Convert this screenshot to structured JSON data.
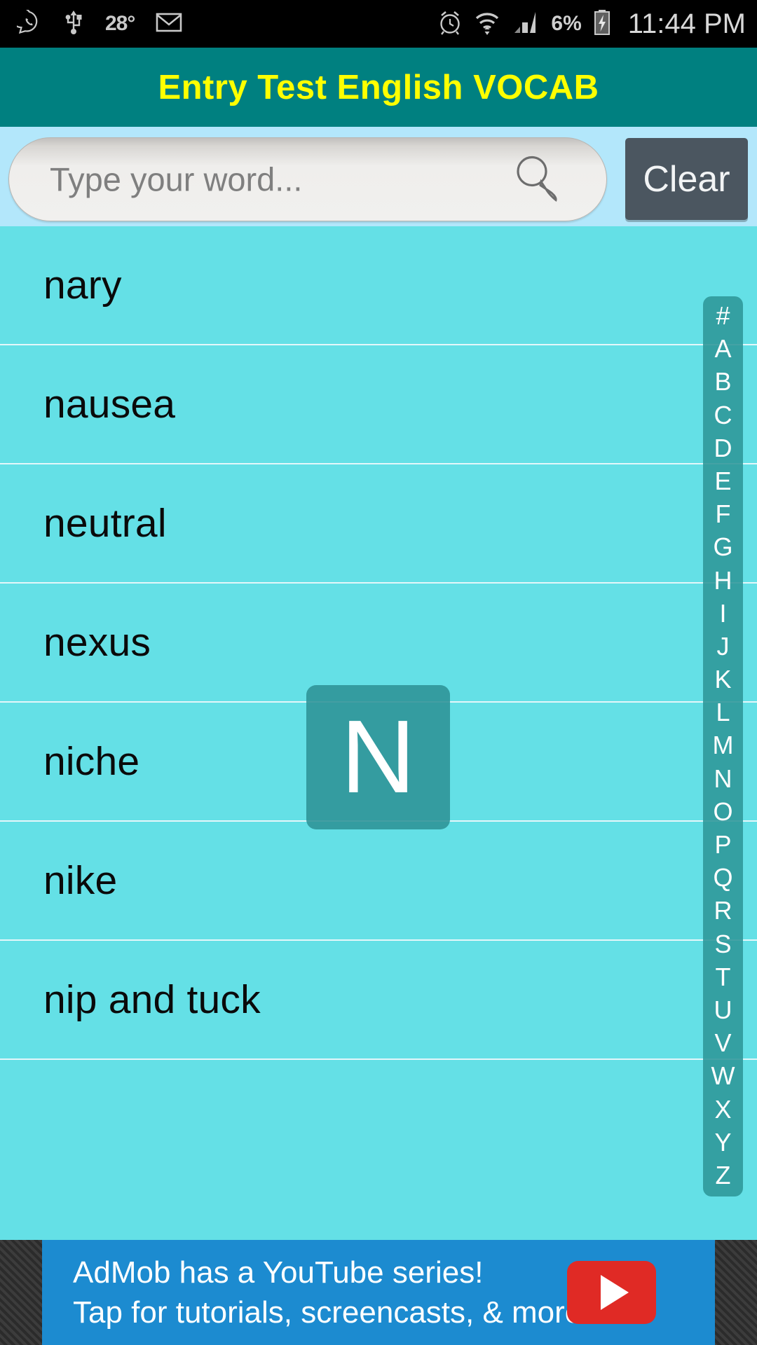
{
  "status_bar": {
    "icons_left": [
      {
        "name": "whatsapp-icon"
      },
      {
        "name": "usb-icon"
      },
      {
        "name": "temperature-indicator",
        "label": "28°"
      },
      {
        "name": "gmail-icon"
      }
    ],
    "icons_right": [
      {
        "name": "alarm-icon"
      },
      {
        "name": "wifi-icon"
      },
      {
        "name": "cellular-signal-icon"
      }
    ],
    "battery_percent": "6%",
    "battery_state": "charging",
    "clock": "11:44 PM"
  },
  "title_bar": {
    "title": "Entry Test English VOCAB",
    "background_color": "#008080",
    "text_color": "#ffff00"
  },
  "search": {
    "placeholder": "Type your word...",
    "value": "",
    "search_icon": "search-icon",
    "clear_label": "Clear",
    "bar_background": "#b3e7fb",
    "clear_button_color": "#4b5660"
  },
  "list": {
    "background": "#64e0e6",
    "divider_color": "#e4f7fa",
    "items": [
      {
        "word": "nary"
      },
      {
        "word": "nausea"
      },
      {
        "word": "neutral"
      },
      {
        "word": "nexus"
      },
      {
        "word": "niche"
      },
      {
        "word": "nike"
      },
      {
        "word": "nip and tuck"
      }
    ]
  },
  "alpha_index": {
    "letters": [
      "#",
      "A",
      "B",
      "C",
      "D",
      "E",
      "F",
      "G",
      "H",
      "I",
      "J",
      "K",
      "L",
      "M",
      "N",
      "O",
      "P",
      "Q",
      "R",
      "S",
      "T",
      "U",
      "V",
      "W",
      "X",
      "Y",
      "Z"
    ],
    "background_color": "#2e9698",
    "text_color": "#ffffff"
  },
  "letter_overlay": {
    "letter": "N",
    "background_color": "#2e9296",
    "text_color": "#ffffff"
  },
  "ad": {
    "line1": "AdMob has a YouTube series!",
    "line2": "Tap for tutorials, screencasts, & more.",
    "background_color": "#1c8bd0",
    "button_icon": "youtube-play-icon",
    "button_color": "#e02a25"
  }
}
